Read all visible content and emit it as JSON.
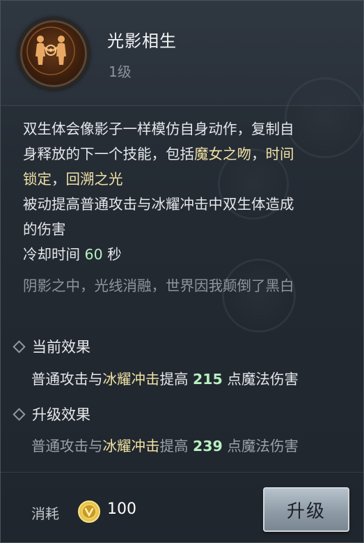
{
  "skill": {
    "name": "光影相生",
    "level": "1级",
    "icon": "twin-figures-icon"
  },
  "description": {
    "line1": "双生体会像影子一样模仿自身动作，复制自",
    "line2_prefix": "身释放的下一个技能，包括",
    "skill_a": "魔女之吻",
    "sep1": "，",
    "skill_b": "时间",
    "skill_b2": "锁定",
    "sep2": "，",
    "skill_c": "回溯之光",
    "line4": "被动提高普通攻击与冰耀冲击中双生体造成",
    "line5": "的伤害",
    "cooldown_prefix": "冷却时间 ",
    "cooldown_value": "60",
    "cooldown_suffix": " 秒"
  },
  "flavor_text": "阴影之中，光线消融，世界因我颠倒了黑白",
  "current_effect": {
    "heading": "当前效果",
    "prefix": "普通攻击与",
    "skill": "冰耀冲击",
    "mid": "提高 ",
    "value": "215",
    "suffix": " 点魔法伤害"
  },
  "upgrade_effect": {
    "heading": "升级效果",
    "prefix": "普通攻击与",
    "skill": "冰耀冲击",
    "mid": "提高 ",
    "value": "239",
    "suffix": " 点魔法伤害"
  },
  "footer": {
    "cost_label": "消耗",
    "cost_icon": "gold-coin-icon",
    "cost_value": "100",
    "upgrade_label": "升级"
  },
  "colors": {
    "highlight_gold": "#f0e2a6",
    "highlight_green": "#b8f0c2",
    "muted": "#8e959d"
  }
}
